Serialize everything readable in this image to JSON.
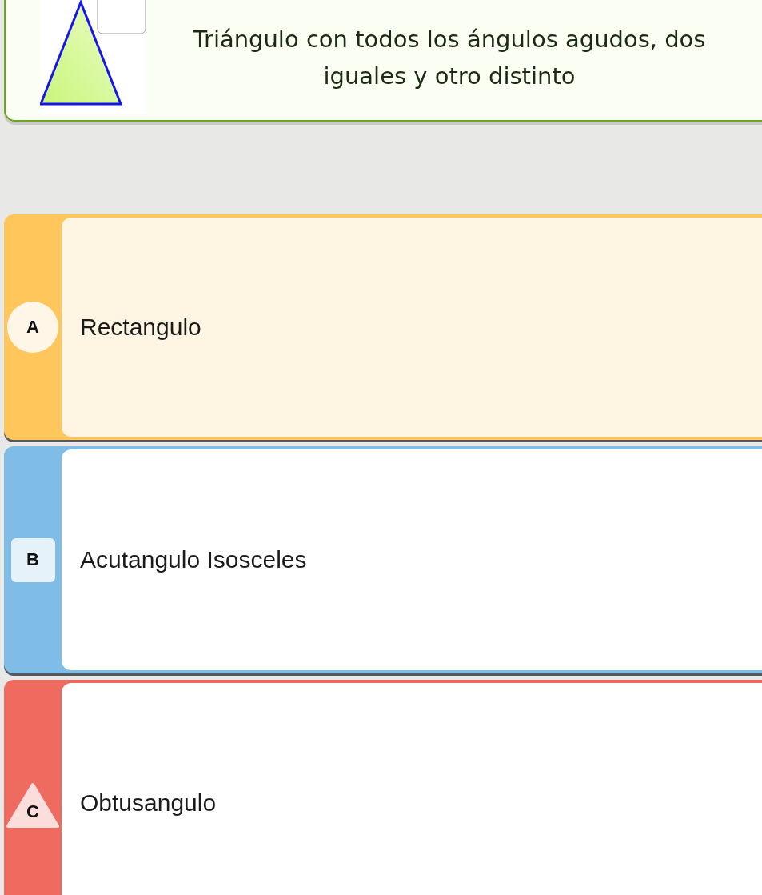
{
  "question": {
    "text": "Triángulo con todos los ángulos agudos, dos iguales y otro distinto"
  },
  "options": [
    {
      "letter": "A",
      "label": "Rectangulo",
      "kind": "circle",
      "color": "#ffc65c",
      "selected": true
    },
    {
      "letter": "B",
      "label": "Acutangulo Isosceles",
      "kind": "square",
      "color": "#7fbce6",
      "selected": false
    },
    {
      "letter": "C",
      "label": "Obtusangulo",
      "kind": "triangle",
      "color": "#ef6b60",
      "selected": false
    }
  ]
}
